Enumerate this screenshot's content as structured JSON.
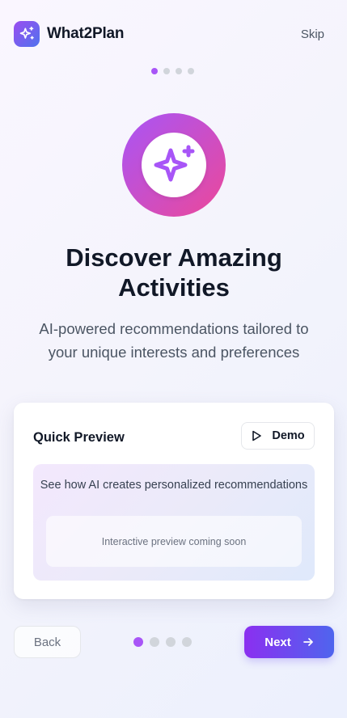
{
  "header": {
    "app_name": "What2Plan",
    "skip_label": "Skip",
    "logo_icon": "sparkles-icon"
  },
  "progress": {
    "total_steps": 4,
    "current_step": 1
  },
  "hero": {
    "icon": "sparkles-icon",
    "title": "Discover Amazing Activities",
    "subtitle": "AI-powered recommendations tailored to your unique interests and preferences"
  },
  "preview_card": {
    "title": "Quick Preview",
    "demo_label": "Demo",
    "demo_icon": "play-icon",
    "description": "See how AI creates personalized recommendations",
    "placeholder": "Interactive preview coming soon"
  },
  "footer": {
    "back_label": "Back",
    "next_label": "Next",
    "next_icon": "arrow-right-icon"
  },
  "colors": {
    "accent_purple": "#a855f7",
    "accent_pink": "#ec4899",
    "accent_blue": "#4f65ee",
    "inactive_dot": "#d1d5db"
  }
}
